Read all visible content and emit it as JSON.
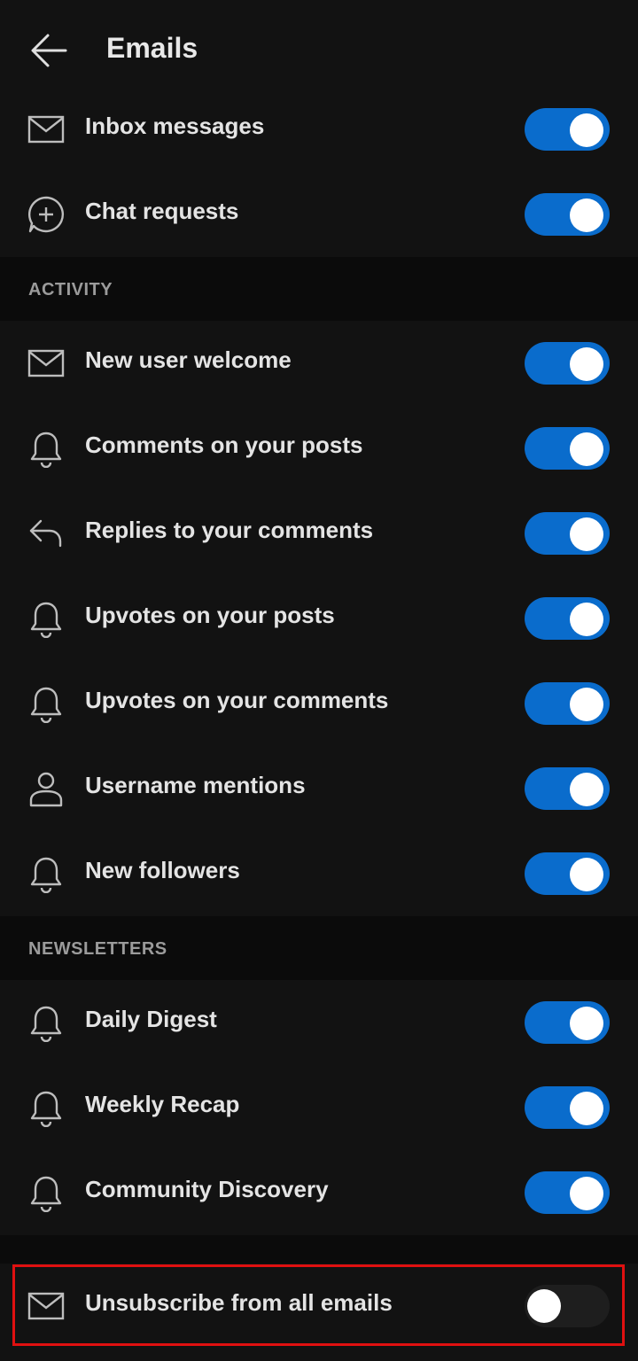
{
  "header": {
    "title": "Emails"
  },
  "top_rows": [
    {
      "label": "Inbox messages",
      "icon": "mail-icon",
      "on": true
    },
    {
      "label": "Chat requests",
      "icon": "chat-add-icon",
      "on": true
    }
  ],
  "activity": {
    "heading": "ACTIVITY",
    "rows": [
      {
        "label": "New user welcome",
        "icon": "mail-icon",
        "on": true
      },
      {
        "label": "Comments on your posts",
        "icon": "bell-icon",
        "on": true
      },
      {
        "label": "Replies to your comments",
        "icon": "reply-icon",
        "on": true
      },
      {
        "label": "Upvotes on your posts",
        "icon": "bell-icon",
        "on": true
      },
      {
        "label": "Upvotes on your comments",
        "icon": "bell-icon",
        "on": true
      },
      {
        "label": "Username mentions",
        "icon": "user-icon",
        "on": true
      },
      {
        "label": "New followers",
        "icon": "bell-icon",
        "on": true
      }
    ]
  },
  "newsletters": {
    "heading": "NEWSLETTERS",
    "rows": [
      {
        "label": "Daily Digest",
        "icon": "bell-icon",
        "on": true
      },
      {
        "label": "Weekly Recap",
        "icon": "bell-icon",
        "on": true
      },
      {
        "label": "Community Discovery",
        "icon": "bell-icon",
        "on": true
      }
    ]
  },
  "unsubscribe": {
    "label": "Unsubscribe from all emails",
    "icon": "mail-icon",
    "on": false
  },
  "colors": {
    "accent": "#0a6ccc",
    "highlight": "#e01010",
    "background": "#121212"
  }
}
